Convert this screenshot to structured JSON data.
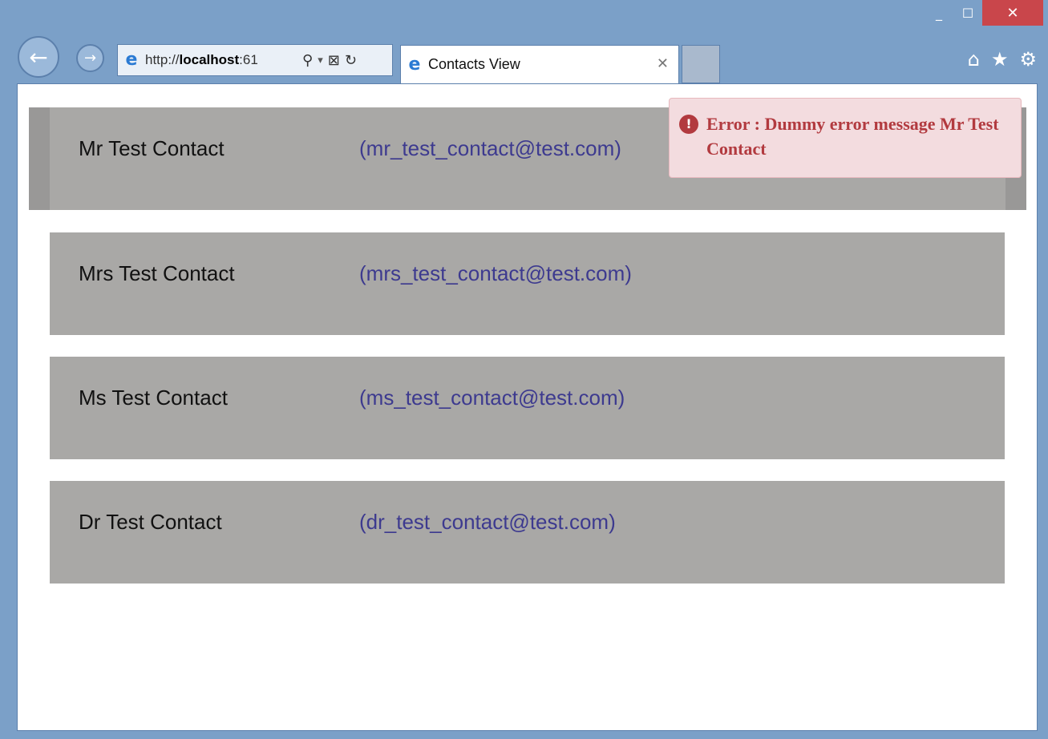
{
  "window": {
    "minimize_icon": "minimize-icon",
    "maximize_icon": "maximize-icon",
    "close_icon": "close-icon",
    "minimize_glyph": "_",
    "maximize_glyph": "☐",
    "close_glyph": "✕"
  },
  "nav": {
    "back_glyph": "←",
    "forward_glyph": "→"
  },
  "address_bar": {
    "url_prefix": "http://",
    "url_host": "localhost",
    "url_rest": ":61",
    "search_glyph": "⚲",
    "dropdown_glyph": "▾",
    "compat_glyph": "⊠",
    "refresh_glyph": "↻"
  },
  "tab": {
    "title": "Contacts View",
    "close_glyph": "✕"
  },
  "toolbar": {
    "home_glyph": "⌂",
    "favorites_glyph": "★",
    "settings_glyph": "⚙"
  },
  "contacts": [
    {
      "name": "Mr Test Contact",
      "email": "(mr_test_contact@test.com)"
    },
    {
      "name": "Mrs Test Contact",
      "email": "(mrs_test_contact@test.com)"
    },
    {
      "name": "Ms Test Contact",
      "email": "(ms_test_contact@test.com)"
    },
    {
      "name": "Dr Test Contact",
      "email": "(dr_test_contact@test.com)"
    }
  ],
  "error": {
    "icon_glyph": "!",
    "message": "Error : Dummy error message Mr Test Contact"
  },
  "colors": {
    "window_frame": "#7ba0c8",
    "close_button": "#c9464b",
    "row_background": "#a9a8a6",
    "selected_row_border": "#999897",
    "email_text": "#3d3a8f",
    "error_background": "#f3dcdf",
    "error_text": "#b23a3f"
  }
}
